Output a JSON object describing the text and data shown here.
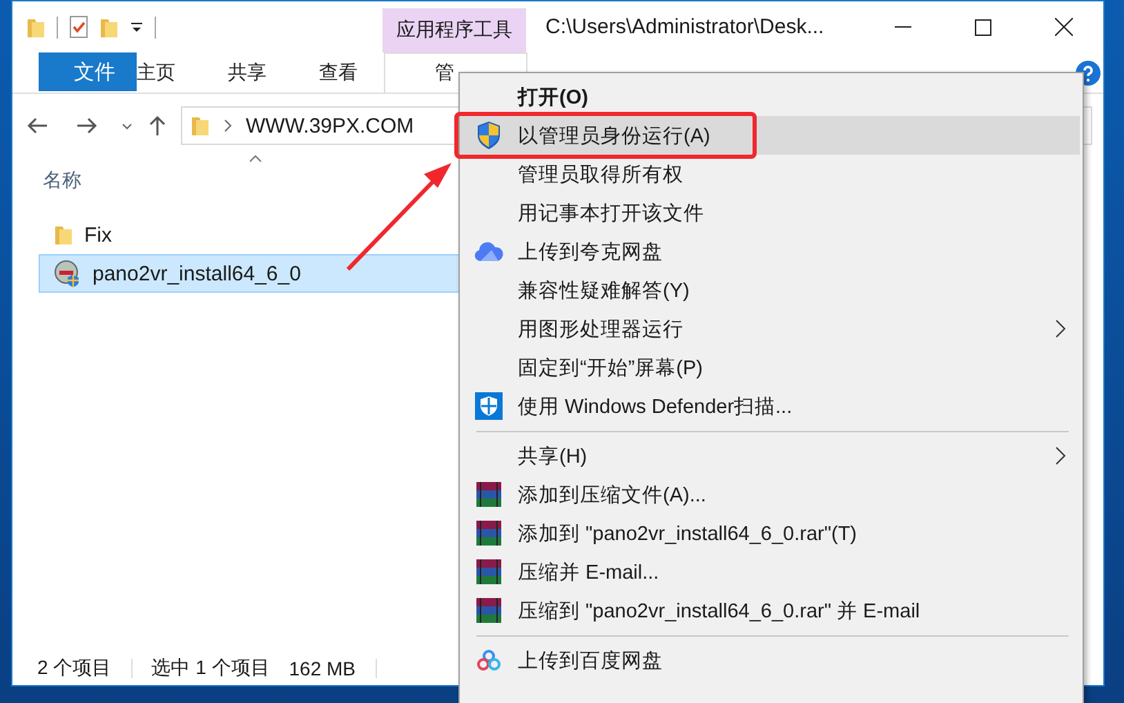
{
  "window": {
    "title": "C:\\Users\\Administrator\\Desk...",
    "context_tab": "应用程序工具"
  },
  "ribbon_tabs": [
    {
      "label": "文件",
      "kind": "file"
    },
    {
      "label": "主页",
      "kind": "normal"
    },
    {
      "label": "共享",
      "kind": "normal"
    },
    {
      "label": "查看",
      "kind": "normal"
    },
    {
      "label": "管",
      "kind": "context"
    }
  ],
  "address": {
    "path": "WWW.39PX.COM"
  },
  "columns": [
    {
      "label": "名称"
    }
  ],
  "files": [
    {
      "name": "Fix",
      "kind": "folder",
      "selected": false
    },
    {
      "name": "pano2vr_install64_6_0",
      "kind": "installer",
      "selected": true
    }
  ],
  "status_bar": {
    "count": "2 个项目",
    "selection": "选中 1 个项目",
    "size": "162 MB"
  },
  "context_menu": {
    "items": [
      {
        "kind": "plain",
        "label": "打开(O)",
        "default": true,
        "selected": false,
        "submenu": false
      },
      {
        "kind": "shield",
        "label": "以管理员身份运行(A)",
        "default": false,
        "selected": true,
        "submenu": false
      },
      {
        "kind": "plain",
        "label": "管理员取得所有权",
        "default": false,
        "selected": false,
        "submenu": false
      },
      {
        "kind": "plain",
        "label": "用记事本打开该文件",
        "default": false,
        "selected": false,
        "submenu": false
      },
      {
        "kind": "cloud",
        "label": "上传到夸克网盘",
        "default": false,
        "selected": false,
        "submenu": false
      },
      {
        "kind": "plain",
        "label": "兼容性疑难解答(Y)",
        "default": false,
        "selected": false,
        "submenu": false
      },
      {
        "kind": "plain",
        "label": "用图形处理器运行",
        "default": false,
        "selected": false,
        "submenu": true
      },
      {
        "kind": "plain",
        "label": "固定到“开始”屏幕(P)",
        "default": false,
        "selected": false,
        "submenu": false
      },
      {
        "kind": "defender",
        "label": "使用 Windows Defender扫描...",
        "default": false,
        "selected": false,
        "submenu": false
      },
      {
        "kind": "separator"
      },
      {
        "kind": "plain",
        "label": "共享(H)",
        "default": false,
        "selected": false,
        "submenu": true
      },
      {
        "kind": "archive",
        "label": "添加到压缩文件(A)...",
        "default": false,
        "selected": false,
        "submenu": false
      },
      {
        "kind": "archive",
        "label": "添加到 \"pano2vr_install64_6_0.rar\"(T)",
        "default": false,
        "selected": false,
        "submenu": false
      },
      {
        "kind": "archive",
        "label": "压缩并 E-mail...",
        "default": false,
        "selected": false,
        "submenu": false
      },
      {
        "kind": "archive",
        "label": "压缩到 \"pano2vr_install64_6_0.rar\" 并 E-mail",
        "default": false,
        "selected": false,
        "submenu": false
      },
      {
        "kind": "separator"
      },
      {
        "kind": "rings",
        "label": "上传到百度网盘",
        "default": false,
        "selected": false,
        "submenu": false
      }
    ]
  },
  "annotation": {
    "arrow": true,
    "highlight_frame": true
  }
}
